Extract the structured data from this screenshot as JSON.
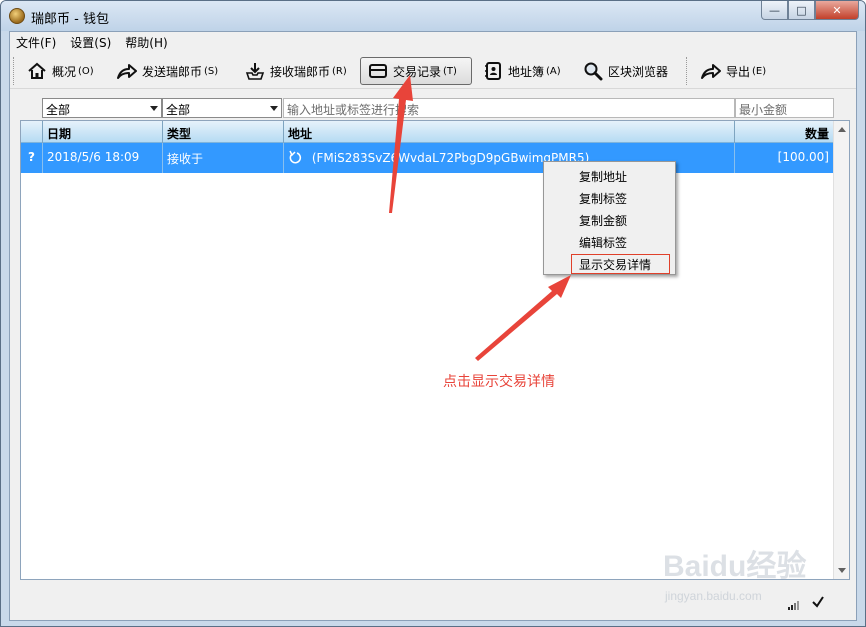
{
  "window": {
    "title": "瑞郎币 - 钱包"
  },
  "menubar": {
    "items": [
      "文件(F)",
      "设置(S)",
      "帮助(H)"
    ]
  },
  "toolbar": {
    "overview": {
      "label": "概况",
      "key": "(O)"
    },
    "send": {
      "label": "发送瑞郎币",
      "key": "(S)"
    },
    "receive": {
      "label": "接收瑞郎币",
      "key": "(R)"
    },
    "transactions": {
      "label": "交易记录",
      "key": "(T)"
    },
    "addressbook": {
      "label": "地址簿",
      "key": "(A)"
    },
    "explorer": {
      "label": "区块浏览器",
      "key": ""
    },
    "export": {
      "label": "导出",
      "key": "(E)"
    }
  },
  "filters": {
    "date_select": "全部",
    "type_select": "全部",
    "address_placeholder": "输入地址或标签进行搜索",
    "min_amount_placeholder": "最小金额"
  },
  "table": {
    "headers": {
      "date": "日期",
      "type": "类型",
      "address": "地址",
      "amount": "数量"
    },
    "rows": [
      {
        "status": "?",
        "date": "2018/5/6 18:09",
        "type": "接收于",
        "address": "(FMiS283SvZ6WvdaL72PbgD9pGBwimqPMR5)",
        "amount": "[100.00]"
      }
    ]
  },
  "context_menu": {
    "items": [
      "复制地址",
      "复制标签",
      "复制金额",
      "编辑标签",
      "显示交易详情"
    ],
    "highlighted_index": 4
  },
  "annotation": {
    "text": "点击显示交易详情",
    "color": "#e8443a"
  },
  "watermark": {
    "text": "Baidu经验",
    "sub": "jingyan.baidu.com"
  },
  "colors": {
    "selection": "#3399ff",
    "accent_red": "#e8443a"
  }
}
